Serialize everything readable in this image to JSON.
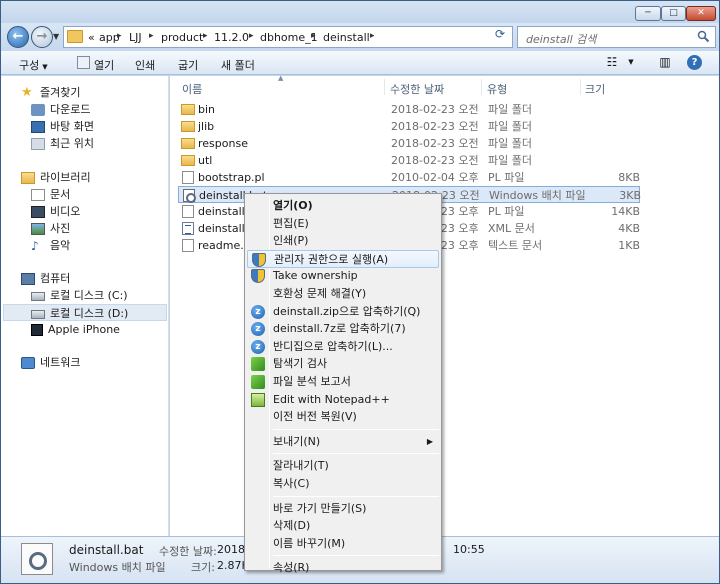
{
  "window": {
    "min_glyph": "─",
    "max_glyph": "□",
    "close_glyph": "✕"
  },
  "nav": {
    "breadcrumbs": [
      "app",
      "LJJ",
      "product",
      "11.2.0",
      "dbhome_1",
      "deinstall"
    ],
    "overflow": "«",
    "search_placeholder": "deinstall 검색"
  },
  "toolbar": {
    "organize": "구성",
    "open": "열기",
    "print": "인쇄",
    "burn": "굽기",
    "new_folder": "새 폴더"
  },
  "sidebar": {
    "favorites": {
      "label": "즐겨찾기",
      "items": [
        "다운로드",
        "바탕 화면",
        "최근 위치"
      ]
    },
    "libraries": {
      "label": "라이브러리",
      "items": [
        "문서",
        "비디오",
        "사진",
        "음악"
      ]
    },
    "computer": {
      "label": "컴퓨터",
      "items": [
        "로컬 디스크 (C:)",
        "로컬 디스크 (D:)",
        "Apple iPhone"
      ]
    },
    "network": {
      "label": "네트워크"
    }
  },
  "columns": {
    "name": "이름",
    "date": "수정한 날짜",
    "type": "유형",
    "size": "크기"
  },
  "files": [
    {
      "name": "bin",
      "date": "2018-02-23 오전...",
      "type": "파일 폴더",
      "size": "",
      "icon": "folder"
    },
    {
      "name": "jlib",
      "date": "2018-02-23 오전...",
      "type": "파일 폴더",
      "size": "",
      "icon": "folder"
    },
    {
      "name": "response",
      "date": "2018-02-23 오전...",
      "type": "파일 폴더",
      "size": "",
      "icon": "folder"
    },
    {
      "name": "utl",
      "date": "2018-02-23 오전...",
      "type": "파일 폴더",
      "size": "",
      "icon": "folder"
    },
    {
      "name": "bootstrap.pl",
      "date": "2010-02-04 오후...",
      "type": "PL 파일",
      "size": "8KB",
      "icon": "doc"
    },
    {
      "name": "deinstall.bat",
      "date": "2018-02-23 오전...",
      "type": "Windows 배치 파일",
      "size": "3KB",
      "icon": "bat"
    },
    {
      "name": "deinstall.pl",
      "date": "2018-02-23 오후...",
      "type": "PL 파일",
      "size": "14KB",
      "icon": "doc"
    },
    {
      "name": "deinstall.xml",
      "date": "2018-02-23 오후...",
      "type": "XML 문서",
      "size": "4KB",
      "icon": "xml"
    },
    {
      "name": "readme.txt",
      "date": "2018-02-23 오후...",
      "type": "텍스트 문서",
      "size": "1KB",
      "icon": "doc"
    }
  ],
  "details": {
    "name": "deinstall.bat",
    "type": "Windows 배치 파일",
    "modified_label": "수정한 날짜:",
    "modified_value": "2018-0",
    "size_label": "크기:",
    "size_value": "2.87KB",
    "time_tail": "10:55"
  },
  "context_menu": [
    {
      "label": "열기(O)",
      "bold": true
    },
    {
      "label": "편집(E)"
    },
    {
      "label": "인쇄(P)"
    },
    {
      "label": "관리자 권한으로 실행(A)",
      "icon": "shield-icon",
      "hover": true
    },
    {
      "label": "Take ownership",
      "icon": "shield-icon"
    },
    {
      "label": "호환성 문제 해결(Y)"
    },
    {
      "label": "deinstall.zip으로 압축하기(Q)",
      "icon": "bandizip-icon"
    },
    {
      "label": "deinstall.7z로 압축하기(7)",
      "icon": "bandizip-icon"
    },
    {
      "label": "반디집으로 압축하기(L)...",
      "icon": "bandizip-icon"
    },
    {
      "label": "탐색기 검사",
      "icon": "scan-icon"
    },
    {
      "label": "파일 분석 보고서",
      "icon": "scan-icon"
    },
    {
      "label": "Edit with Notepad++",
      "icon": "notepadpp-icon"
    },
    {
      "label": "이전 버전 복원(V)"
    },
    {
      "sep": true
    },
    {
      "label": "보내기(N)",
      "submenu": true
    },
    {
      "sep": true
    },
    {
      "label": "잘라내기(T)"
    },
    {
      "label": "복사(C)"
    },
    {
      "sep": true
    },
    {
      "label": "바로 가기 만들기(S)"
    },
    {
      "label": "삭제(D)"
    },
    {
      "label": "이름 바꾸기(M)"
    },
    {
      "sep": true
    },
    {
      "label": "속성(R)"
    }
  ]
}
